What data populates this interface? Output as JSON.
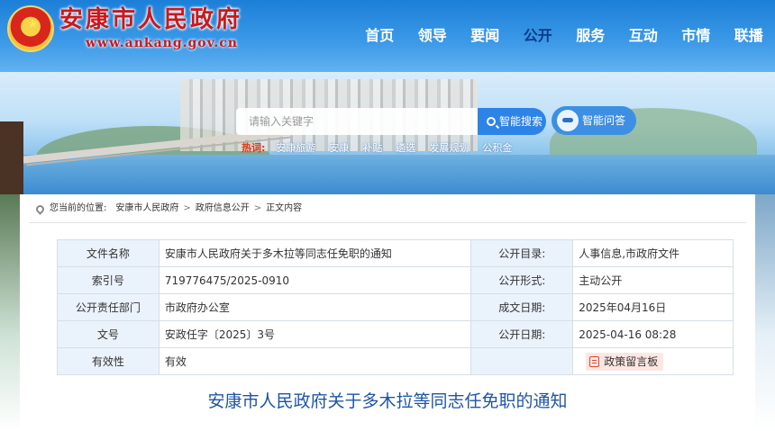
{
  "header": {
    "site_title": "安康市人民政府",
    "site_url": "www.ankang.gov.cn",
    "nav": [
      "首页",
      "领导",
      "要闻",
      "公开",
      "服务",
      "互动",
      "市情",
      "联播"
    ],
    "nav_active_index": 3
  },
  "search": {
    "placeholder": "请输入关键字",
    "search_button": "智能搜索",
    "qa_button": "智能问答",
    "hot_label": "热词:",
    "hot_words": [
      "安康旅游",
      "安康",
      "补贴",
      "遴选",
      "发展规划",
      "公积金"
    ]
  },
  "breadcrumb": {
    "prefix": "您当前的位置:",
    "items": [
      "安康市人民政府",
      "政府信息公开",
      "正文内容"
    ]
  },
  "meta": {
    "file_name_label": "文件名称",
    "file_name": "安康市人民政府关于多木拉等同志任免职的通知",
    "catalog_label": "公开目录:",
    "catalog": "人事信息,市政府文件",
    "index_label": "索引号",
    "index": "719776475/2025-0910",
    "form_label": "公开形式:",
    "form": "主动公开",
    "dept_label": "公开责任部门",
    "dept": "市政府办公室",
    "date_label": "成文日期:",
    "date": "2025年04月16日",
    "doc_no_label": "文号",
    "doc_no": "安政任字〔2025〕3号",
    "publish_label": "公开日期:",
    "publish": "2025-04-16 08:28",
    "validity_label": "有效性",
    "validity": "有效",
    "message_button": "政策留言板"
  },
  "document": {
    "title": "安康市人民政府关于多木拉等同志任免职的通知"
  },
  "colors": {
    "header_blue": "#2c8be0",
    "title_red": "#c8191e",
    "doc_title_blue": "#1f55a3",
    "label_bg": "#eaf2fb"
  }
}
